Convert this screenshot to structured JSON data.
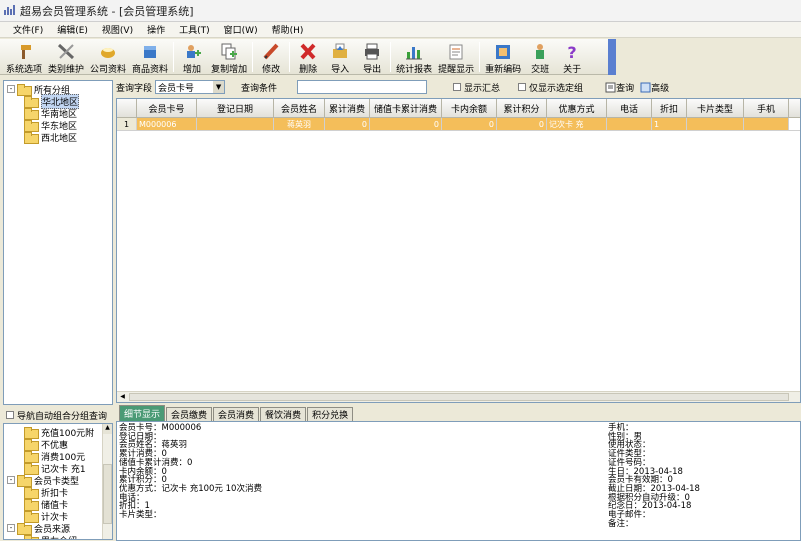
{
  "window": {
    "title": "超易会员管理系统 - [会员管理系统]"
  },
  "menu": [
    "文件(F)",
    "编辑(E)",
    "视图(V)",
    "操作",
    "工具(T)",
    "窗口(W)",
    "帮助(H)"
  ],
  "toolbar": {
    "items": [
      {
        "label": "系统选项",
        "icon": "hammer-icon",
        "color": "#d89a2a"
      },
      {
        "label": "类别维护",
        "icon": "tools-icon",
        "color": "#888"
      },
      {
        "label": "公司资料",
        "icon": "cup-icon",
        "color": "#e0a82a"
      },
      {
        "label": "商品资料",
        "icon": "box-icon",
        "color": "#3a78c8"
      },
      {
        "label": "增加",
        "icon": "add-user-icon",
        "color": "#4aa84a"
      },
      {
        "label": "复制增加",
        "icon": "copy-add-icon",
        "color": "#4aa84a"
      },
      {
        "label": "修改",
        "icon": "pencil-icon",
        "color": "#c84a2a"
      },
      {
        "label": "删除",
        "icon": "delete-icon",
        "color": "#d02a2a"
      },
      {
        "label": "导入",
        "icon": "import-icon",
        "color": "#e0b040"
      },
      {
        "label": "导出",
        "icon": "printer-icon",
        "color": "#555"
      },
      {
        "label": "统计报表",
        "icon": "bar-chart-icon",
        "color": "#3aa03a"
      },
      {
        "label": "提醒显示",
        "icon": "reminder-icon",
        "color": "#d06a2a"
      },
      {
        "label": "重新编码",
        "icon": "recode-icon",
        "color": "#3a78c8"
      },
      {
        "label": "交班",
        "icon": "handover-icon",
        "color": "#3aa05a"
      },
      {
        "label": "关于",
        "icon": "help-icon",
        "color": "#8a3ac8"
      }
    ]
  },
  "tree1": {
    "root": "所有分组",
    "items": [
      "华北地区",
      "华南地区",
      "华东地区",
      "西北地区"
    ],
    "selected": "华北地区"
  },
  "nav": {
    "label": "导航自动组合分组查询"
  },
  "tree2": {
    "items": [
      {
        "text": "充值100元附",
        "level": 2,
        "exp": ""
      },
      {
        "text": "不优惠",
        "level": 2,
        "exp": ""
      },
      {
        "text": "消费100元",
        "level": 2,
        "exp": ""
      },
      {
        "text": "记次卡 充1",
        "level": 2,
        "exp": ""
      },
      {
        "text": "会员卡类型",
        "level": 1,
        "exp": "-"
      },
      {
        "text": "折扣卡",
        "level": 2,
        "exp": ""
      },
      {
        "text": "储值卡",
        "level": 2,
        "exp": ""
      },
      {
        "text": "计次卡",
        "level": 2,
        "exp": ""
      },
      {
        "text": "会员来源",
        "level": 1,
        "exp": "-"
      },
      {
        "text": "男友介绍",
        "level": 2,
        "exp": ""
      }
    ]
  },
  "query": {
    "field_label": "查询字段",
    "field_value": "会员卡号",
    "cond_label": "查询条件",
    "cond_value": "",
    "summary": "显示汇总",
    "only_selected": "仅显示选定组",
    "search": "查询",
    "advanced": "高级"
  },
  "grid": {
    "columns": [
      "会员卡号",
      "登记日期",
      "会员姓名",
      "累计消费",
      "储值卡累计消费",
      "卡内余额",
      "累计积分",
      "优惠方式",
      "电话",
      "折扣",
      "卡片类型",
      "手机"
    ],
    "rows": [
      {
        "num": "1",
        "cells": [
          "M000006",
          "",
          "蒋英羽",
          "0",
          "0",
          "0",
          "0",
          "记次卡 充",
          "",
          "1",
          "",
          ""
        ]
      }
    ]
  },
  "tabs": [
    "细节显示",
    "会员缴费",
    "会员消费",
    "餐饮消费",
    "积分兑换"
  ],
  "detail": {
    "left": [
      "会员卡号：M000006",
      "登记日期：",
      "会员姓名：蒋英羽",
      "累计消费：0",
      "储值卡累计消费：0",
      "卡内余额：0",
      "累计积分：0",
      "优惠方式：记次卡 充100元 10次消费",
      "电话：",
      "折扣：1",
      "卡片类型："
    ],
    "right": [
      "手机：",
      "性别：男",
      "使用状态：",
      "证件类型：",
      "证件号码：",
      "生日：2013-04-18",
      "会员卡有效期：0",
      "截止日期：2013-04-18",
      "根据积分自动升级：0",
      "纪念日：2013-04-18",
      "电子邮件：",
      "备注："
    ]
  }
}
